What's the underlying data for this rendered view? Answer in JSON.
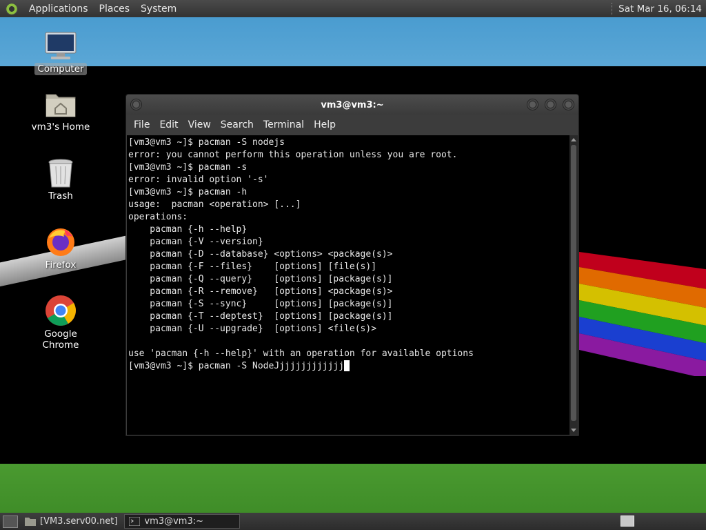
{
  "top_panel": {
    "menus": [
      "Applications",
      "Places",
      "System"
    ],
    "clock": "Sat Mar 16, 06:14"
  },
  "desktop_icons": [
    {
      "label": "Computer",
      "icon": "computer-icon",
      "selected": true
    },
    {
      "label": "vm3's Home",
      "icon": "home-folder-icon"
    },
    {
      "label": "Trash",
      "icon": "trash-icon"
    },
    {
      "label": "Firefox",
      "icon": "firefox-icon"
    },
    {
      "label": "Google Chrome",
      "icon": "chrome-icon"
    }
  ],
  "terminal": {
    "title": "vm3@vm3:~",
    "menu": [
      "File",
      "Edit",
      "View",
      "Search",
      "Terminal",
      "Help"
    ],
    "lines": [
      "[vm3@vm3 ~]$ pacman -S nodejs",
      "error: you cannot perform this operation unless you are root.",
      "[vm3@vm3 ~]$ pacman -s",
      "error: invalid option '-s'",
      "[vm3@vm3 ~]$ pacman -h",
      "usage:  pacman <operation> [...]",
      "operations:",
      "    pacman {-h --help}",
      "    pacman {-V --version}",
      "    pacman {-D --database} <options> <package(s)>",
      "    pacman {-F --files}    [options] [file(s)]",
      "    pacman {-Q --query}    [options] [package(s)]",
      "    pacman {-R --remove}   [options] <package(s)>",
      "    pacman {-S --sync}     [options] [package(s)]",
      "    pacman {-T --deptest}  [options] [package(s)]",
      "    pacman {-U --upgrade}  [options] <file(s)>",
      "",
      "use 'pacman {-h --help}' with an operation for available options"
    ],
    "current_input": "[vm3@vm3 ~]$ pacman -S NodeJjjjjjjjjjjjj"
  },
  "taskbar": {
    "tasks": [
      {
        "label": "[VM3.serv00.net]",
        "icon": "folder-icon",
        "active": false
      },
      {
        "label": "vm3@vm3:~",
        "icon": "terminal-icon",
        "active": true
      }
    ]
  }
}
